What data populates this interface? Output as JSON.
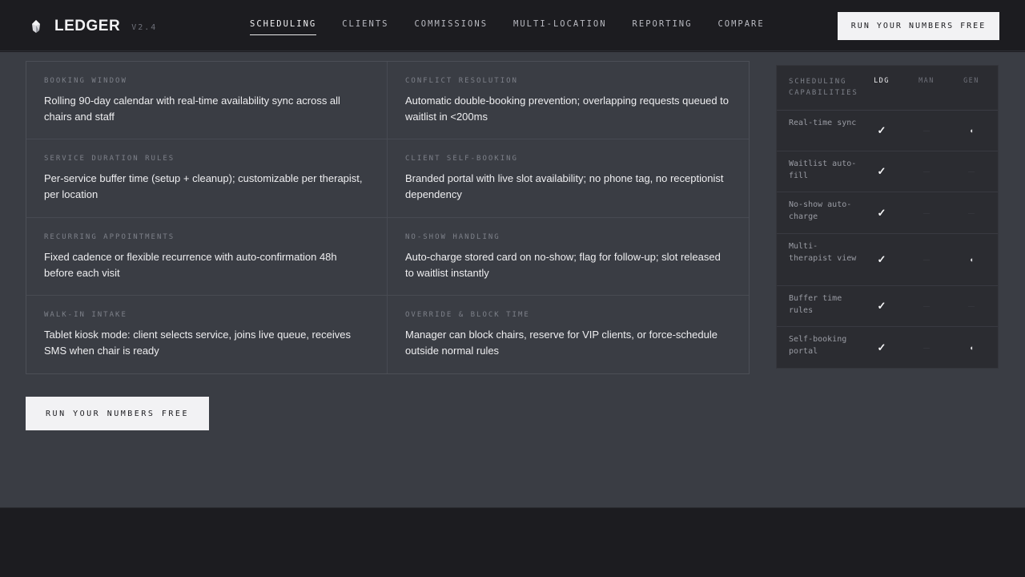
{
  "header": {
    "brand": "LEDGER",
    "version": "V2.4",
    "nav": [
      "SCHEDULING",
      "CLIENTS",
      "COMMISSIONS",
      "MULTI-LOCATION",
      "REPORTING",
      "COMPARE"
    ],
    "active_nav": "SCHEDULING",
    "cta": "RUN YOUR NUMBERS FREE"
  },
  "features": [
    {
      "label": "BOOKING WINDOW",
      "text": "Rolling 90-day calendar with real-time availability sync across all chairs and staff"
    },
    {
      "label": "CONFLICT RESOLUTION",
      "text": "Automatic double-booking prevention; overlapping requests queued to waitlist in <200ms"
    },
    {
      "label": "SERVICE DURATION RULES",
      "text": "Per-service buffer time (setup + cleanup); customizable per therapist, per location"
    },
    {
      "label": "CLIENT SELF-BOOKING",
      "text": "Branded portal with live slot availability; no phone tag, no receptionist dependency"
    },
    {
      "label": "RECURRING APPOINTMENTS",
      "text": "Fixed cadence or flexible recurrence with auto-confirmation 48h before each visit"
    },
    {
      "label": "NO-SHOW HANDLING",
      "text": "Auto-charge stored card on no-show; flag for follow-up; slot released to waitlist instantly"
    },
    {
      "label": "WALK-IN INTAKE",
      "text": "Tablet kiosk mode: client selects service, joins live queue, receives SMS when chair is ready"
    },
    {
      "label": "OVERRIDE & BLOCK TIME",
      "text": "Manager can block chairs, reserve for VIP clients, or force-schedule outside normal rules"
    }
  ],
  "cta_bottom": "RUN YOUR NUMBERS FREE",
  "comparison": {
    "title": "SCHEDULING CAPABILITIES",
    "columns": [
      "LDG",
      "MAN",
      "GEN"
    ],
    "rows": [
      {
        "label": "Real-time sync",
        "ldg": "✓",
        "man": "—",
        "gen": "◖"
      },
      {
        "label": "Waitlist auto-fill",
        "ldg": "✓",
        "man": "—",
        "gen": "—"
      },
      {
        "label": "No-show auto-charge",
        "ldg": "✓",
        "man": "—",
        "gen": "—"
      },
      {
        "label": "Multi-therapist view",
        "ldg": "✓",
        "man": "—",
        "gen": "◖"
      },
      {
        "label": "Buffer time rules",
        "ldg": "✓",
        "man": "—",
        "gen": "—"
      },
      {
        "label": "Self-booking portal",
        "ldg": "✓",
        "man": "—",
        "gen": "◖"
      }
    ]
  },
  "colors": {
    "background": "#1c1c20",
    "main_panel": "#3a3d44",
    "table_panel": "#2b2c31",
    "cta": "#f2f2f4"
  }
}
